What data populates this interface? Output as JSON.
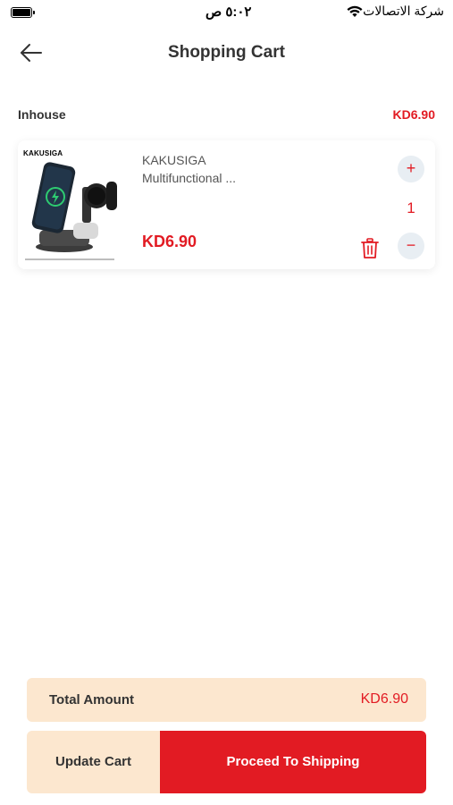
{
  "status_bar": {
    "time": "٥:٠٢ ص",
    "carrier": "شركة الاتصالات"
  },
  "header": {
    "title": "Shopping Cart",
    "back_icon": "arrow-left-icon"
  },
  "seller": {
    "name": "Inhouse",
    "total": "KD6.90"
  },
  "cart_items": [
    {
      "image_brand": "KAKUSIGA",
      "name": "KAKUSIGA\nMultifunctional ...",
      "price": "KD6.90",
      "quantity": "1",
      "plus_label": "+",
      "minus_label": "−"
    }
  ],
  "summary": {
    "label": "Total Amount",
    "value": "KD6.90"
  },
  "actions": {
    "update_label": "Update Cart",
    "proceed_label": "Proceed To Shipping"
  },
  "colors": {
    "accent": "#e21b23",
    "cream": "#fce7cf"
  }
}
